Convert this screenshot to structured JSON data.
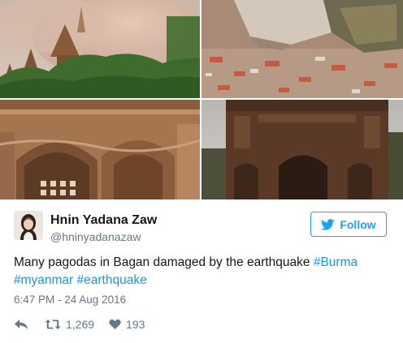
{
  "tweet": {
    "author": {
      "display_name": "Hnin Yadana Zaw",
      "handle": "@hninyadanazaw",
      "avatar_icon": "profile-photo"
    },
    "follow_button": {
      "label": "Follow",
      "icon": "bird-icon"
    },
    "text_parts": [
      {
        "type": "text",
        "value": "Many pagodas in Bagan damaged by the earthquake "
      },
      {
        "type": "hashtag",
        "value": "#Burma"
      },
      {
        "type": "text",
        "value": " "
      },
      {
        "type": "hashtag",
        "value": "#myanmar"
      },
      {
        "type": "text",
        "value": " "
      },
      {
        "type": "hashtag",
        "value": "#earthquake"
      }
    ],
    "timestamp": "6:47 PM - 24 Aug 2016",
    "actions": {
      "reply_icon": "reply-arrow-icon",
      "retweet_icon": "retweet-icon",
      "retweet_count": "1,269",
      "like_icon": "heart-icon",
      "like_count": "193"
    },
    "photos": [
      "pagoda-dust-cloud",
      "collapsed-rubble",
      "temple-facade-closeup",
      "temple-at-dusk"
    ]
  },
  "colors": {
    "link": "#1b95e0",
    "brand": "#1da1f2",
    "secondary_text": "#657786",
    "primary_text": "#14171a"
  }
}
